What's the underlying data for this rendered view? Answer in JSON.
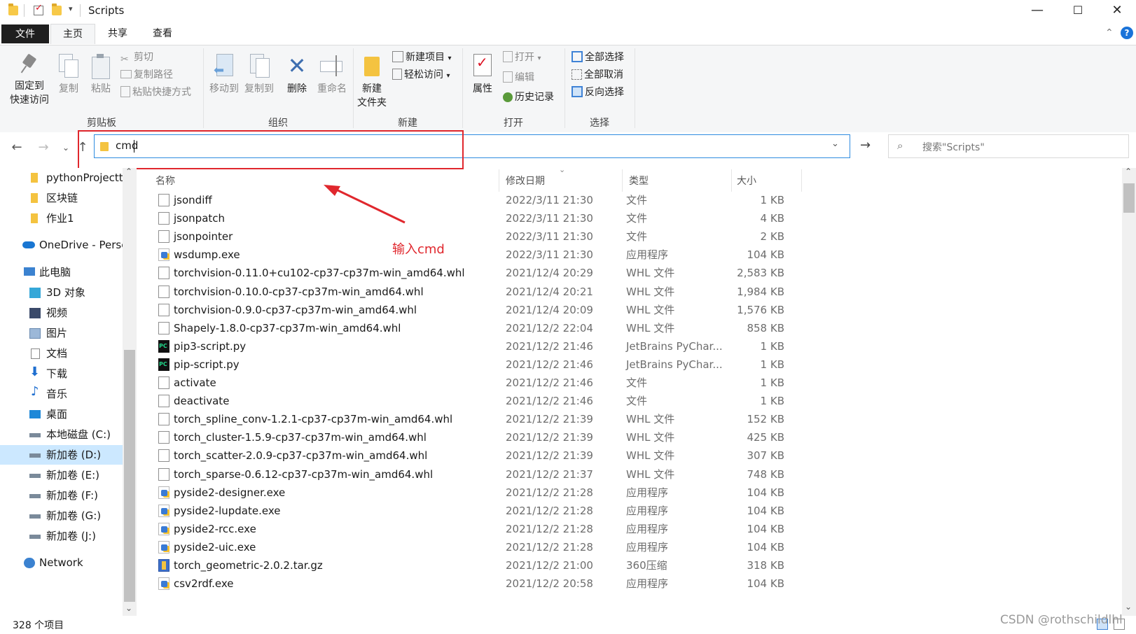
{
  "window": {
    "title": "Scripts",
    "controls": {
      "minimize": "—",
      "maximize": "☐",
      "close": "✕"
    }
  },
  "tabs": {
    "file": "文件",
    "home": "主页",
    "share": "共享",
    "view": "查看"
  },
  "ribbon": {
    "clipboard": {
      "label": "剪贴板",
      "pin": "固定到\n快速访问",
      "pin_l1": "固定到",
      "pin_l2": "快速访问",
      "copy": "复制",
      "paste": "粘贴",
      "cut": "剪切",
      "copy_path": "复制路径",
      "paste_shortcut": "粘贴快捷方式"
    },
    "organize": {
      "label": "组织",
      "move_to": "移动到",
      "copy_to": "复制到",
      "delete": "删除",
      "rename": "重命名"
    },
    "new": {
      "label": "新建",
      "new_folder_l1": "新建",
      "new_folder_l2": "文件夹",
      "new_item": "新建项目",
      "easy_access": "轻松访问"
    },
    "open": {
      "label": "打开",
      "properties": "属性",
      "open": "打开",
      "edit": "编辑",
      "history": "历史记录"
    },
    "select": {
      "label": "选择",
      "select_all": "全部选择",
      "select_none": "全部取消",
      "invert": "反向选择"
    }
  },
  "address": {
    "value": "cmd",
    "search_placeholder": "搜索\"Scripts\""
  },
  "annotation": {
    "text": "输入cmd"
  },
  "nav": [
    {
      "label": "pythonProjectt",
      "icon": "folder-icon"
    },
    {
      "label": "区块链",
      "icon": "folder-icon"
    },
    {
      "label": "作业1",
      "icon": "folder-icon"
    },
    {
      "label": "OneDrive - Persc",
      "icon": "cloud-icon"
    },
    {
      "label": "此电脑",
      "icon": "computer-icon"
    },
    {
      "label": "3D 对象",
      "icon": "cube-icon"
    },
    {
      "label": "视频",
      "icon": "video-icon"
    },
    {
      "label": "图片",
      "icon": "picture-icon"
    },
    {
      "label": "文档",
      "icon": "document-icon"
    },
    {
      "label": "下载",
      "icon": "download-icon"
    },
    {
      "label": "音乐",
      "icon": "music-icon"
    },
    {
      "label": "桌面",
      "icon": "desktop-icon"
    },
    {
      "label": "本地磁盘 (C:)",
      "icon": "drive-icon"
    },
    {
      "label": "新加卷 (D:)",
      "icon": "drive-icon"
    },
    {
      "label": "新加卷 (E:)",
      "icon": "drive-icon"
    },
    {
      "label": "新加卷 (F:)",
      "icon": "drive-icon"
    },
    {
      "label": "新加卷 (G:)",
      "icon": "drive-icon"
    },
    {
      "label": "新加卷 (J:)",
      "icon": "drive-icon"
    },
    {
      "label": "Network",
      "icon": "network-icon"
    }
  ],
  "columns": {
    "name": "名称",
    "date": "修改日期",
    "type": "类型",
    "size": "大小"
  },
  "files": [
    {
      "name": "jsondiff",
      "date": "2022/3/11 21:30",
      "type": "文件",
      "size": "1 KB",
      "icon": "file"
    },
    {
      "name": "jsonpatch",
      "date": "2022/3/11 21:30",
      "type": "文件",
      "size": "4 KB",
      "icon": "file"
    },
    {
      "name": "jsonpointer",
      "date": "2022/3/11 21:30",
      "type": "文件",
      "size": "2 KB",
      "icon": "file"
    },
    {
      "name": "wsdump.exe",
      "date": "2022/3/11 21:30",
      "type": "应用程序",
      "size": "104 KB",
      "icon": "exe"
    },
    {
      "name": "torchvision-0.11.0+cu102-cp37-cp37m-win_amd64.whl",
      "date": "2021/12/4 20:29",
      "type": "WHL 文件",
      "size": "2,583 KB",
      "icon": "file"
    },
    {
      "name": "torchvision-0.10.0-cp37-cp37m-win_amd64.whl",
      "date": "2021/12/4 20:21",
      "type": "WHL 文件",
      "size": "1,984 KB",
      "icon": "file"
    },
    {
      "name": "torchvision-0.9.0-cp37-cp37m-win_amd64.whl",
      "date": "2021/12/4 20:09",
      "type": "WHL 文件",
      "size": "1,576 KB",
      "icon": "file"
    },
    {
      "name": "Shapely-1.8.0-cp37-cp37m-win_amd64.whl",
      "date": "2021/12/2 22:04",
      "type": "WHL 文件",
      "size": "858 KB",
      "icon": "file"
    },
    {
      "name": "pip3-script.py",
      "date": "2021/12/2 21:46",
      "type": "JetBrains PyChar...",
      "size": "1 KB",
      "icon": "pc"
    },
    {
      "name": "pip-script.py",
      "date": "2021/12/2 21:46",
      "type": "JetBrains PyChar...",
      "size": "1 KB",
      "icon": "pc"
    },
    {
      "name": "activate",
      "date": "2021/12/2 21:46",
      "type": "文件",
      "size": "1 KB",
      "icon": "file"
    },
    {
      "name": "deactivate",
      "date": "2021/12/2 21:46",
      "type": "文件",
      "size": "1 KB",
      "icon": "file"
    },
    {
      "name": "torch_spline_conv-1.2.1-cp37-cp37m-win_amd64.whl",
      "date": "2021/12/2 21:39",
      "type": "WHL 文件",
      "size": "152 KB",
      "icon": "file"
    },
    {
      "name": "torch_cluster-1.5.9-cp37-cp37m-win_amd64.whl",
      "date": "2021/12/2 21:39",
      "type": "WHL 文件",
      "size": "425 KB",
      "icon": "file"
    },
    {
      "name": "torch_scatter-2.0.9-cp37-cp37m-win_amd64.whl",
      "date": "2021/12/2 21:39",
      "type": "WHL 文件",
      "size": "307 KB",
      "icon": "file"
    },
    {
      "name": "torch_sparse-0.6.12-cp37-cp37m-win_amd64.whl",
      "date": "2021/12/2 21:37",
      "type": "WHL 文件",
      "size": "748 KB",
      "icon": "file"
    },
    {
      "name": "pyside2-designer.exe",
      "date": "2021/12/2 21:28",
      "type": "应用程序",
      "size": "104 KB",
      "icon": "exe"
    },
    {
      "name": "pyside2-lupdate.exe",
      "date": "2021/12/2 21:28",
      "type": "应用程序",
      "size": "104 KB",
      "icon": "exe"
    },
    {
      "name": "pyside2-rcc.exe",
      "date": "2021/12/2 21:28",
      "type": "应用程序",
      "size": "104 KB",
      "icon": "exe"
    },
    {
      "name": "pyside2-uic.exe",
      "date": "2021/12/2 21:28",
      "type": "应用程序",
      "size": "104 KB",
      "icon": "exe"
    },
    {
      "name": "torch_geometric-2.0.2.tar.gz",
      "date": "2021/12/2 21:00",
      "type": "360压缩",
      "size": "318 KB",
      "icon": "zip"
    },
    {
      "name": "csv2rdf.exe",
      "date": "2021/12/2 20:58",
      "type": "应用程序",
      "size": "104 KB",
      "icon": "exe"
    }
  ],
  "status": {
    "count": "328 个项目"
  },
  "watermark": "CSDN @rothschildlhl"
}
